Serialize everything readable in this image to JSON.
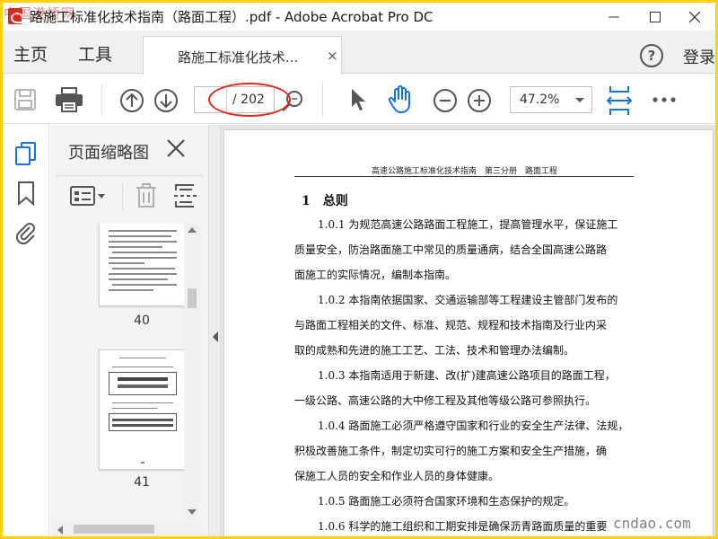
{
  "window": {
    "title": "路施工标准化技术指南（路面工程）.pdf - Adobe Acrobat Pro DC",
    "watermark": "中国港桥网"
  },
  "tabs": {
    "home": "主页",
    "tools": "工具",
    "document": "路施工标准化技术...",
    "close": "×",
    "help": "?",
    "login": "登录"
  },
  "toolbar": {
    "page_current": "",
    "page_total": "/ 202",
    "zoom": "47.2%"
  },
  "thumbnails": {
    "title": "页面缩略图",
    "pages": [
      "40",
      "41"
    ]
  },
  "document": {
    "running_head": "高速公路施工标准化技术指南　第三分册　路面工程",
    "section_title": "1　总则",
    "lines": [
      "1.0.1 为规范高速公路路面工程施工，提高管理水平，保证施工",
      "质量安全，防治路面施工中常见的质量通病，结合全国高速公路路",
      "面施工的实际情况，编制本指南。",
      "1.0.2 本指南依据国家、交通运输部等工程建设主管部门发布的",
      "与路面工程相关的文件、标准、规范、规程和技术指南及行业内采",
      "取的成熟和先进的施工工艺、工法、技术和管理办法编制。",
      "1.0.3 本指南适用于新建、改(扩)建高速公路项目的路面工程，",
      "一级公路、高速公路的大中修工程及其他等级公路可参照执行。",
      "1.0.4 路面施工必须严格遵守国家和行业的安全生产法律、法规，",
      "积极改善施工条件，制定切实可行的施工方案和安全生产措施，确",
      "保施工人员的安全和作业人员的身体健康。",
      "1.0.5 路面施工必须符合国家环境和生态保护的规定。",
      "1.0.6 科学的施工组织和工期安排是确保沥青路面质量的重要"
    ]
  },
  "site_mark": "cndao.com",
  "colors": {
    "accent_blue": "#1473e6",
    "highlight_red": "#e0261c",
    "frame_yellow": "#ffd200"
  },
  "icons": [
    "save-icon",
    "print-icon",
    "prev-page-icon",
    "next-page-icon",
    "zoom-search-icon",
    "select-pointer-icon",
    "hand-tool-icon",
    "zoom-out-icon",
    "zoom-in-icon",
    "fit-page-icon",
    "more-icon",
    "page-thumbnails-icon",
    "bookmark-icon",
    "attachment-icon"
  ]
}
